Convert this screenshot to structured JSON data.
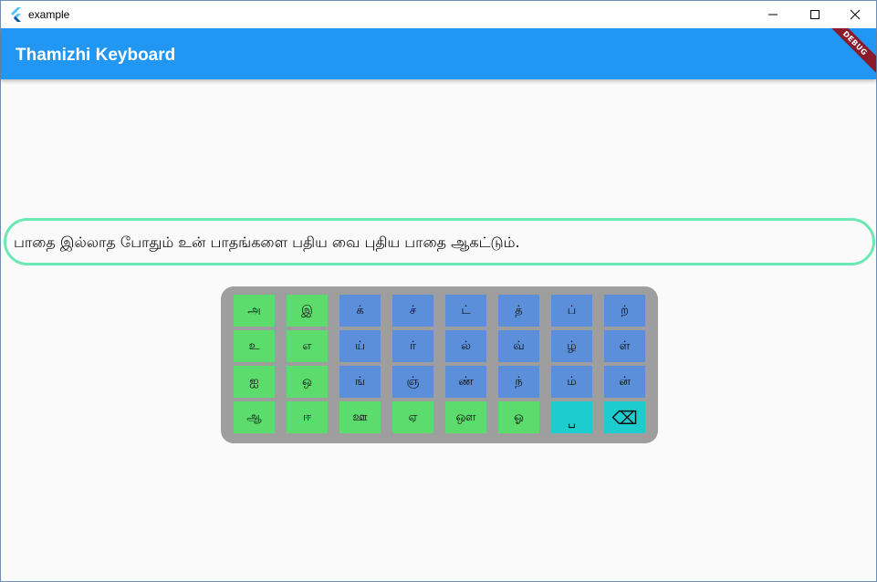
{
  "window": {
    "title": "example"
  },
  "appbar": {
    "title": "Thamizhi Keyboard",
    "debug_banner": "DEBUG"
  },
  "text_field": {
    "value": "பாதை இல்லாத போதும் உன் பாதங்களை பதிய வை புதிய பாதை ஆகட்டும்."
  },
  "keyboard": {
    "colors": {
      "vowel": "#5ddc6e",
      "consonant": "#5b8fd9",
      "special": "#1ccccf",
      "background": "#9e9e9e"
    },
    "rows": [
      [
        {
          "label": "அ",
          "kind": "vowel"
        },
        {
          "label": "இ",
          "kind": "vowel"
        },
        {
          "label": "க்",
          "kind": "consonant"
        },
        {
          "label": "ச்",
          "kind": "consonant"
        },
        {
          "label": "ட்",
          "kind": "consonant"
        },
        {
          "label": "த்",
          "kind": "consonant"
        },
        {
          "label": "ப்",
          "kind": "consonant"
        },
        {
          "label": "ற்",
          "kind": "consonant"
        }
      ],
      [
        {
          "label": "உ",
          "kind": "vowel"
        },
        {
          "label": "எ",
          "kind": "vowel"
        },
        {
          "label": "ய்",
          "kind": "consonant"
        },
        {
          "label": "ர்",
          "kind": "consonant"
        },
        {
          "label": "ல்",
          "kind": "consonant"
        },
        {
          "label": "வ்",
          "kind": "consonant"
        },
        {
          "label": "ழ்",
          "kind": "consonant"
        },
        {
          "label": "ள்",
          "kind": "consonant"
        }
      ],
      [
        {
          "label": "ஐ",
          "kind": "vowel"
        },
        {
          "label": "ஒ",
          "kind": "vowel"
        },
        {
          "label": "ங்",
          "kind": "consonant"
        },
        {
          "label": "ஞ்",
          "kind": "consonant"
        },
        {
          "label": "ண்",
          "kind": "consonant"
        },
        {
          "label": "ந்",
          "kind": "consonant"
        },
        {
          "label": "ம்",
          "kind": "consonant"
        },
        {
          "label": "ன்",
          "kind": "consonant"
        }
      ],
      [
        {
          "label": "ஆ",
          "kind": "vowel"
        },
        {
          "label": "ஈ",
          "kind": "vowel"
        },
        {
          "label": "ஊ",
          "kind": "vowel"
        },
        {
          "label": "ஏ",
          "kind": "vowel"
        },
        {
          "label": "ஔ",
          "kind": "vowel"
        },
        {
          "label": "ஓ",
          "kind": "vowel"
        },
        {
          "label": "␣",
          "kind": "special",
          "icon": "space-icon"
        },
        {
          "label": "⌫",
          "kind": "special",
          "icon": "backspace-icon"
        }
      ]
    ]
  }
}
